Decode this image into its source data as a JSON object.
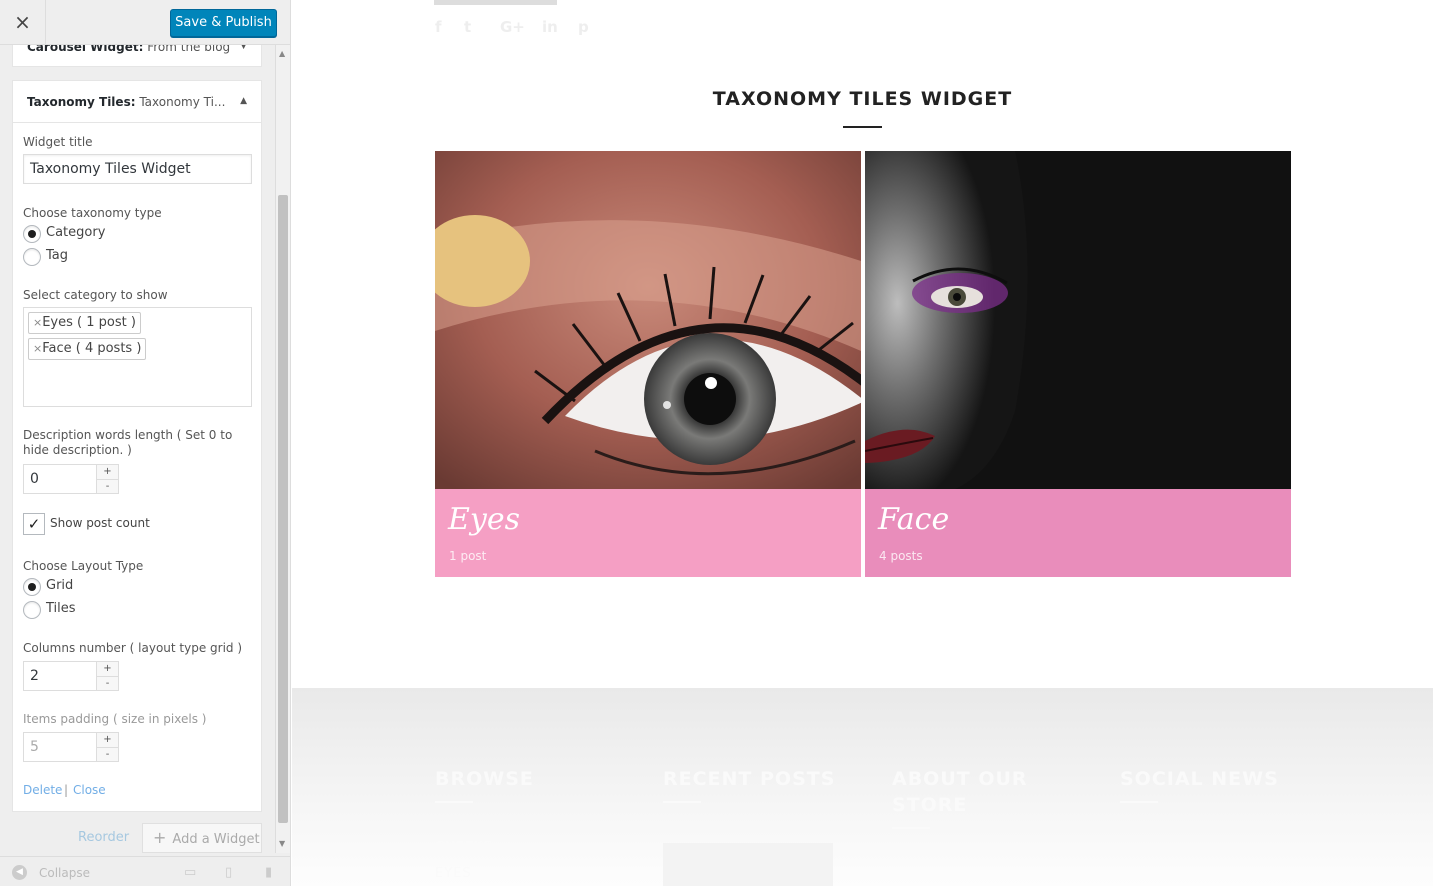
{
  "customizer": {
    "close_glyph": "×",
    "save_label": "Save & Publish",
    "carousel_widget": {
      "title_bold": "Carousel Widget:",
      "title_sub": " From the blog",
      "toggle": "▼"
    },
    "taxonomy_widget": {
      "title_bold": "Taxonomy Tiles:",
      "title_sub": " Taxonomy Ti...",
      "toggle": "▲",
      "widget_title_label": "Widget title",
      "widget_title_value": "Taxonomy Tiles Widget",
      "taxonomy_type_label": "Choose taxonomy type",
      "taxonomy_options": [
        {
          "label": "Category",
          "selected": true
        },
        {
          "label": "Tag",
          "selected": false
        }
      ],
      "category_label": "Select category to show",
      "selected_categories": [
        {
          "x": "×",
          "label": "Eyes ( 1 post )"
        },
        {
          "x": "×",
          "label": "Face ( 4 posts )"
        }
      ],
      "desc_length_label": "Description words length ( Set 0 to hide description. )",
      "desc_length_value": "0",
      "show_post_count_label": "Show post count",
      "show_post_count_checked": true,
      "layout_type_label": "Choose Layout Type",
      "layout_options": [
        {
          "label": "Grid",
          "selected": true
        },
        {
          "label": "Tiles",
          "selected": false
        }
      ],
      "columns_label": "Columns number ( layout type grid )",
      "columns_value": "2",
      "padding_label": "Items padding ( size in pixels )",
      "padding_value": "5",
      "spinner_up": "+",
      "spinner_down": "-",
      "delete_label": "Delete",
      "separator": "|",
      "close_label": "Close"
    },
    "reorder_label": "Reorder",
    "add_widget_label": "Add a Widget",
    "collapse_label": "Collapse"
  },
  "preview": {
    "widget_heading": "TAXONOMY TILES WIDGET",
    "social_icons": [
      "f",
      "t",
      "G+",
      "in",
      "p"
    ],
    "tiles": [
      {
        "name": "Eyes",
        "count": "1 post",
        "band_color": "#f59fc4"
      },
      {
        "name": "Face",
        "count": "4 posts",
        "band_color": "#e98dbb"
      }
    ],
    "footer": {
      "headings": [
        "BROWSE",
        "RECENT POSTS",
        "ABOUT OUR STORE",
        "SOCIAL NEWS"
      ],
      "browse_links": [
        "CHEEKS",
        "EYES"
      ]
    }
  },
  "colors": {
    "accent": "#0085ba",
    "link": "#72aee6",
    "pink": "#f59fc4"
  }
}
